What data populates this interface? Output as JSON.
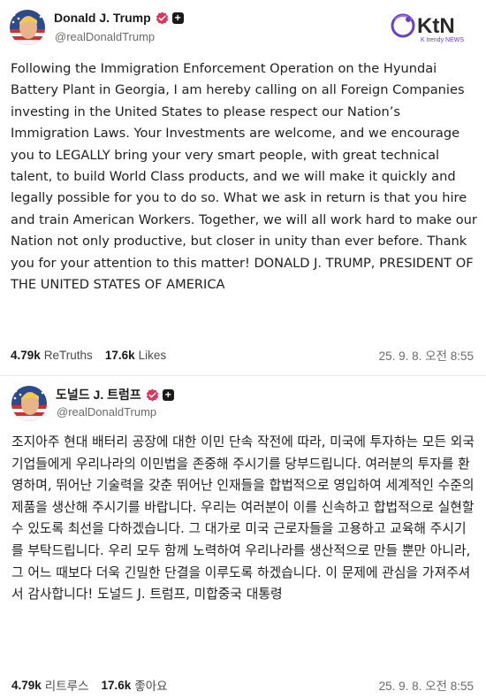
{
  "watermark": {
    "brand": "KtN",
    "tagline": "K trendy NEWS",
    "accent": "#6a3fc9"
  },
  "post_en": {
    "display_name": "Donald J. Trump",
    "handle": "@realDonaldTrump",
    "verified_icon": "verified-badge-icon",
    "follow_icon": "plus-icon",
    "body": "Following the Immigration Enforcement Operation on the Hyundai Battery Plant in Georgia, I am hereby calling on all Foreign Companies investing in the United States to please respect our Nation’s Immigration Laws. Your Investments are welcome, and we encourage you to LEGALLY bring your very smart people, with great technical talent, to build World Class products, and we will make it quickly and legally possible for you to do so. What we ask in return is that you hire and train American Workers. Together, we will all work hard to make our Nation not only productive, but closer in unity than ever before. Thank you for your attention to this matter! DONALD J. TRUMP, PRESIDENT OF THE UNITED STATES OF AMERICA",
    "retruths_count": "4.79k",
    "retruths_label": "ReTruths",
    "likes_count": "17.6k",
    "likes_label": "Likes",
    "timestamp": "25. 9. 8. 오전 8:55"
  },
  "post_ko": {
    "display_name": "도널드 J. 트럼프",
    "handle": "@realDonaldTrump",
    "verified_icon": "verified-badge-icon",
    "follow_icon": "plus-icon",
    "body": "조지아주 현대 배터리 공장에 대한 이민 단속 작전에 따라, 미국에 투자하는 모든 외국 기업들에게 우리나라의 이민법을 존중해 주시기를 당부드립니다. 여러분의 투자를 환영하며, 뛰어난 기술력을 갖춘 뛰어난 인재들을 합법적으로 영입하여 세계적인 수준의 제품을 생산해 주시기를 바랍니다. 우리는 여러분이 이를 신속하고 합법적으로 실현할 수 있도록 최선을 다하겠습니다. 그 대가로 미국 근로자들을 고용하고 교육해 주시기를 부탁드립니다. 우리 모두 함께 노력하여 우리나라를 생산적으로 만들 뿐만 아니라, 그 어느 때보다 더욱 긴밀한 단결을 이루도록 하겠습니다. 이 문제에 관심을 가져주셔서 감사합니다! 도널드 J. 트럼프, 미합중국 대통령",
    "retruths_count": "4.79k",
    "retruths_label": "리트루스",
    "likes_count": "17.6k",
    "likes_label": "좋아요",
    "timestamp": "25. 9. 8. 오전 8:55"
  },
  "colors": {
    "verified": "#e0345a",
    "text": "#1f1f1f",
    "muted": "#6b6b6b"
  }
}
